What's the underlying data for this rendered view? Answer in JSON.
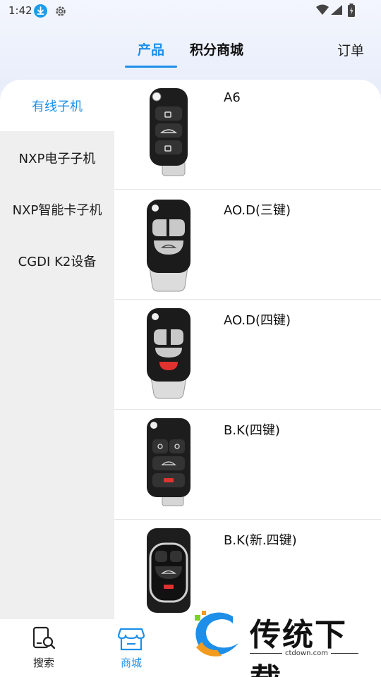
{
  "status_bar": {
    "time": "1:42"
  },
  "header": {
    "tabs": [
      {
        "label": "产品",
        "active": true
      },
      {
        "label": "积分商城",
        "active": false
      }
    ],
    "orders_label": "订单"
  },
  "sidebar": {
    "categories": [
      {
        "label": "有线子机",
        "active": true
      },
      {
        "label": "NXP电子子机",
        "active": false
      },
      {
        "label": "NXP智能卡子机",
        "active": false
      },
      {
        "label": "CGDI K2设备",
        "active": false
      }
    ]
  },
  "products": [
    {
      "name": "A6",
      "style": "three-button"
    },
    {
      "name": "AO.D(三键)",
      "style": "audi-three"
    },
    {
      "name": "AO.D(四键)",
      "style": "audi-four"
    },
    {
      "name": "B.K(四键)",
      "style": "four-panic"
    },
    {
      "name": "B.K(新.四键)",
      "style": "chrome-four"
    }
  ],
  "bottom_nav": [
    {
      "label": "搜索",
      "icon": "search-phone-icon",
      "active": false
    },
    {
      "label": "商城",
      "icon": "store-icon",
      "active": true
    }
  ],
  "watermark": {
    "text": "传统下载",
    "url": "ctdown.com"
  },
  "colors": {
    "accent": "#1e8fe8",
    "sidebar_bg": "#efefef",
    "panic": "#e0322f"
  }
}
